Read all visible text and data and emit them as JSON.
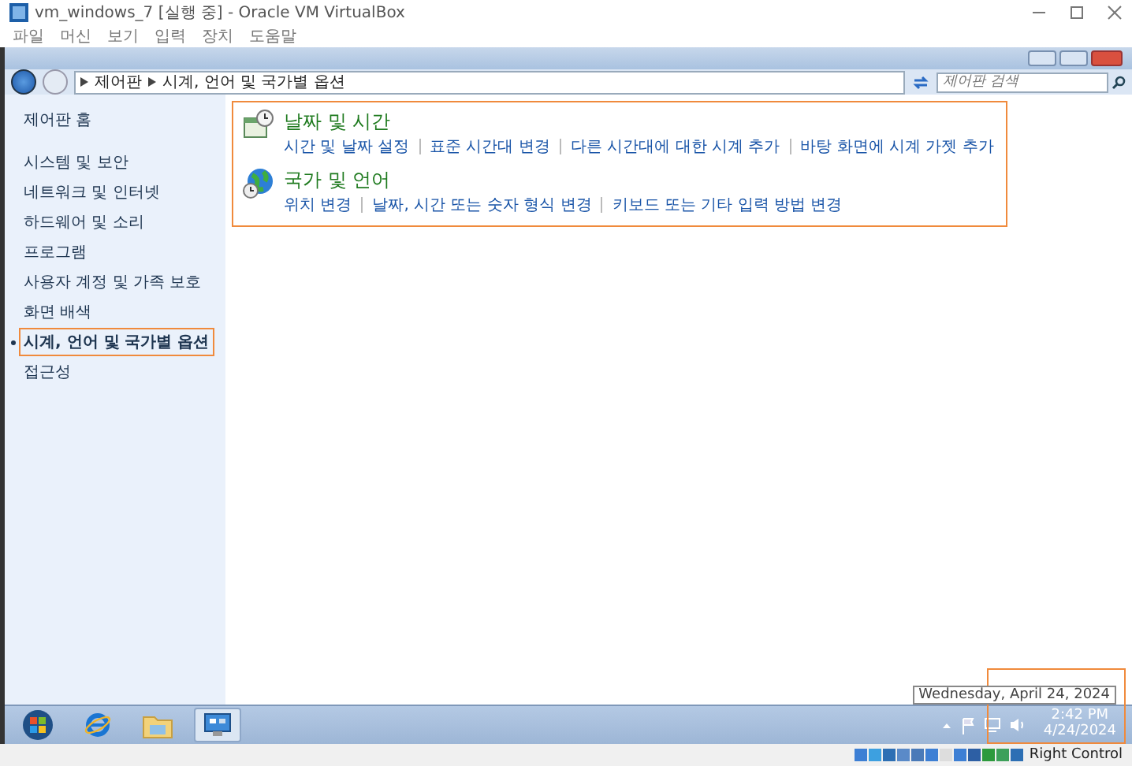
{
  "window": {
    "title": "vm_windows_7 [실행 중] - Oracle VM VirtualBox"
  },
  "menu": [
    "파일",
    "머신",
    "보기",
    "입력",
    "장치",
    "도움말"
  ],
  "address_bar": {
    "path": [
      "제어판",
      "시계, 언어 및 국가별 옵션"
    ],
    "search_placeholder": "제어판 검색"
  },
  "sidebar": {
    "items": [
      {
        "label": "제어판 홈",
        "selected": false
      },
      {
        "label": "시스템 및 보안",
        "selected": false
      },
      {
        "label": "네트워크 및 인터넷",
        "selected": false
      },
      {
        "label": "하드웨어 및 소리",
        "selected": false
      },
      {
        "label": "프로그램",
        "selected": false
      },
      {
        "label": "사용자 계정 및 가족 보호",
        "selected": false
      },
      {
        "label": "화면 배색",
        "selected": false
      },
      {
        "label": "시계, 언어 및 국가별 옵션",
        "selected": true
      },
      {
        "label": "접근성",
        "selected": false
      }
    ]
  },
  "categories": [
    {
      "title": "날짜 및 시간",
      "kind": "clock",
      "links": [
        "시간 및 날짜 설정",
        "표준 시간대 변경",
        "다른 시간대에 대한 시계 추가",
        "바탕 화면에 시계 가젯 추가"
      ]
    },
    {
      "title": "국가 및 언어",
      "kind": "globe",
      "links": [
        "위치 변경",
        "날짜, 시간 또는 숫자 형식 변경",
        "키보드 또는 기타 입력 방법 변경"
      ]
    }
  ],
  "taskbar": {
    "buttons": [
      {
        "kind": "start",
        "selected": false
      },
      {
        "kind": "browser",
        "selected": false
      },
      {
        "kind": "folder",
        "selected": false
      },
      {
        "kind": "control-panel",
        "selected": true
      }
    ],
    "tooltip": "Wednesday, April 24, 2024",
    "time": "2:42 PM",
    "date": "4/24/2024"
  },
  "status_bar": {
    "host_key": "Right Control"
  }
}
